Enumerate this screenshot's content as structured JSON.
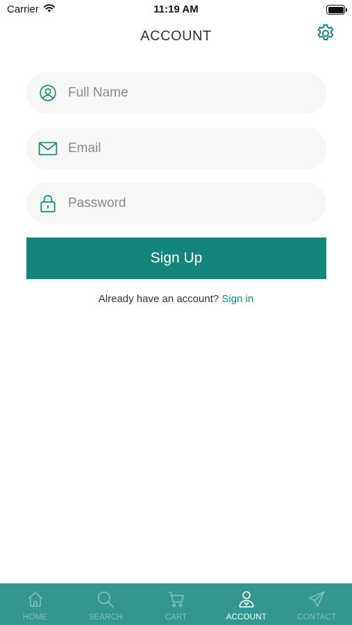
{
  "status_bar": {
    "carrier": "Carrier",
    "time": "11:19 AM",
    "battery_level": 1.0
  },
  "header": {
    "title": "ACCOUNT",
    "settings_icon": "gear-icon"
  },
  "form": {
    "full_name": {
      "placeholder": "Full Name",
      "value": "",
      "icon": "user-circle-icon"
    },
    "email": {
      "placeholder": "Email",
      "value": "",
      "icon": "envelope-icon"
    },
    "password": {
      "placeholder": "Password",
      "value": "",
      "icon": "lock-icon"
    },
    "submit_label": "Sign Up",
    "signin_prompt": "Already have an account?",
    "signin_link": "Sign in"
  },
  "tab_bar": {
    "active": "ACCOUNT",
    "tabs": [
      {
        "label": "HOME",
        "icon": "home-icon"
      },
      {
        "label": "SEARCH",
        "icon": "search-icon"
      },
      {
        "label": "CART",
        "icon": "cart-icon"
      },
      {
        "label": "ACCOUNT",
        "icon": "account-icon"
      },
      {
        "label": "CONTACT",
        "icon": "paper-plane-icon"
      }
    ]
  },
  "colors": {
    "accent": "#14857a",
    "tab_bar_bg": "#359690",
    "tab_inactive": "#7fc2bd",
    "tab_active": "#ffffff",
    "field_bg": "#f7f7f6"
  }
}
